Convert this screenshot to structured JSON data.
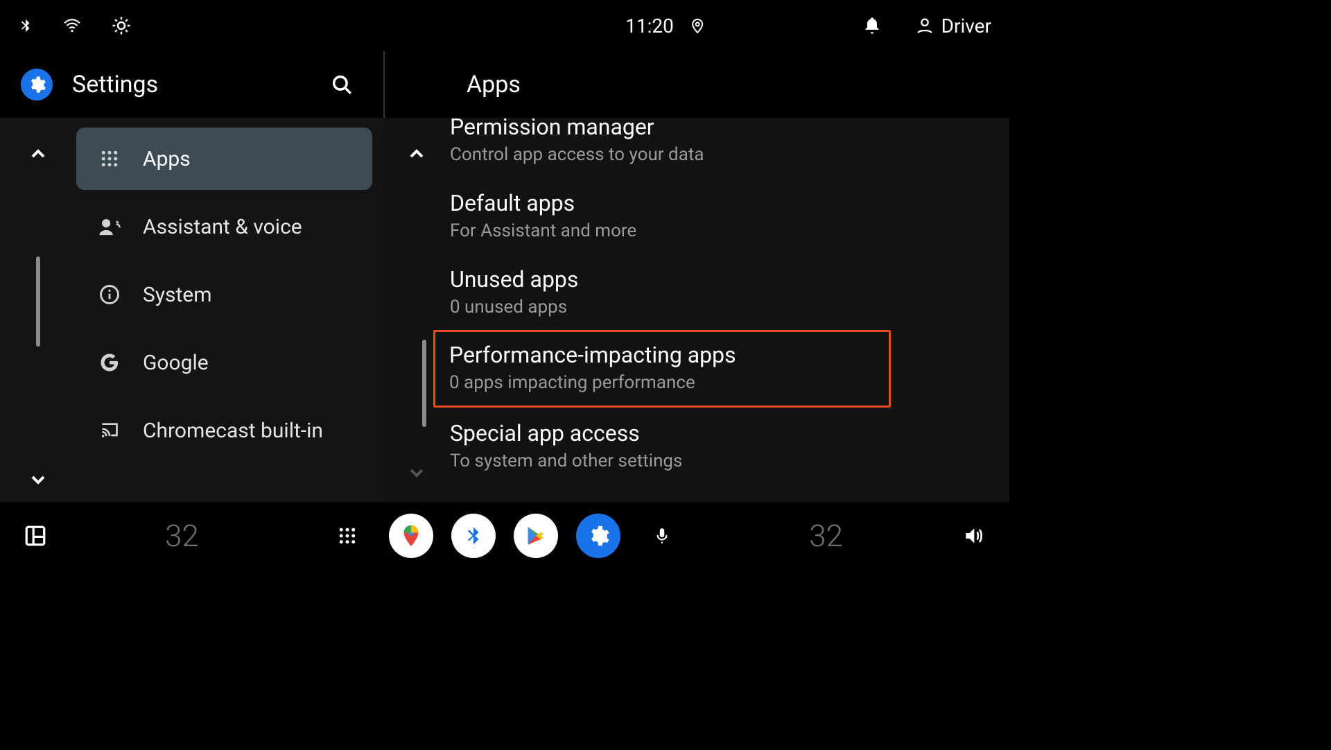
{
  "status": {
    "time": "11:20",
    "user": "Driver"
  },
  "left": {
    "title": "Settings",
    "nav": [
      {
        "label": "Apps",
        "selected": true,
        "icon": "apps"
      },
      {
        "label": "Assistant & voice",
        "selected": false,
        "icon": "assistant"
      },
      {
        "label": "System",
        "selected": false,
        "icon": "info"
      },
      {
        "label": "Google",
        "selected": false,
        "icon": "google"
      },
      {
        "label": "Chromecast built-in",
        "selected": false,
        "icon": "cast"
      }
    ]
  },
  "right": {
    "title": "Apps",
    "items": [
      {
        "title": "Permission manager",
        "sub": "Control app access to your data",
        "highlight": false
      },
      {
        "title": "Default apps",
        "sub": "For Assistant and more",
        "highlight": false
      },
      {
        "title": "Unused apps",
        "sub": "0 unused apps",
        "highlight": false
      },
      {
        "title": "Performance-impacting apps",
        "sub": "0 apps impacting performance",
        "highlight": true
      },
      {
        "title": "Special app access",
        "sub": "To system and other settings",
        "highlight": false
      }
    ]
  },
  "bottom": {
    "temp_left": "32",
    "temp_right": "32"
  }
}
